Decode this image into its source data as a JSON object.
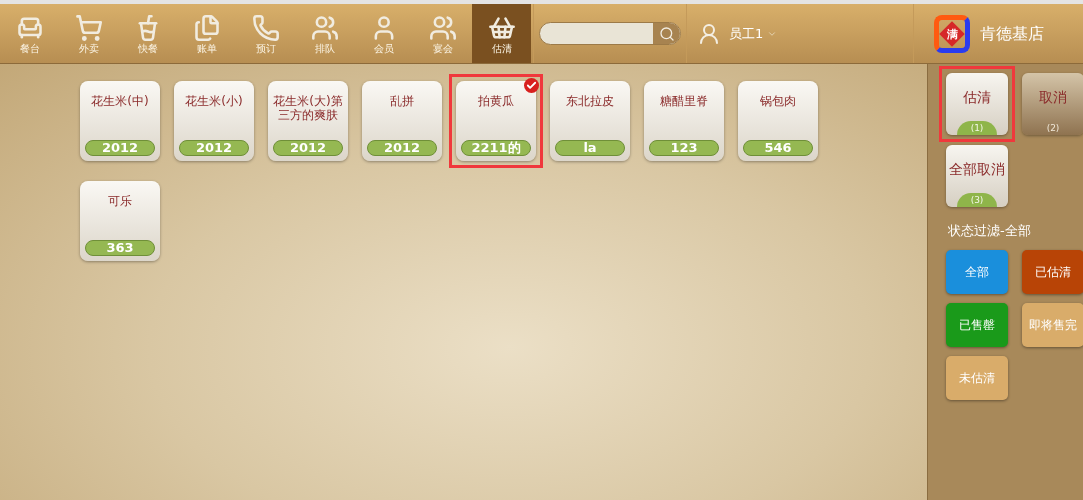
{
  "nav": [
    {
      "label": "餐台",
      "selected": false
    },
    {
      "label": "外卖",
      "selected": false
    },
    {
      "label": "快餐",
      "selected": false
    },
    {
      "label": "账单",
      "selected": false
    },
    {
      "label": "预订",
      "selected": false
    },
    {
      "label": "排队",
      "selected": false
    },
    {
      "label": "会员",
      "selected": false
    },
    {
      "label": "宴会",
      "selected": false
    },
    {
      "label": "估清",
      "selected": true
    }
  ],
  "user": {
    "name": "员工1"
  },
  "brand": {
    "logo_char": "满",
    "name": "肯德基店"
  },
  "dishes": [
    {
      "name": "花生米(中)",
      "count": "2012",
      "checked": false,
      "highlighted": false
    },
    {
      "name": "花生米(小)",
      "count": "2012",
      "checked": false,
      "highlighted": false
    },
    {
      "name": "花生米(大)第三方的爽肤",
      "count": "2012",
      "checked": false,
      "highlighted": false
    },
    {
      "name": "乱拼",
      "count": "2012",
      "checked": false,
      "highlighted": false
    },
    {
      "name": "拍黄瓜",
      "count": "2211的",
      "checked": true,
      "highlighted": true
    },
    {
      "name": "东北拉皮",
      "count": "la",
      "checked": false,
      "highlighted": false
    },
    {
      "name": "糖醋里脊",
      "count": "123",
      "checked": false,
      "highlighted": false
    },
    {
      "name": "锅包肉",
      "count": "546",
      "checked": false,
      "highlighted": false
    },
    {
      "name": "可乐",
      "count": "363",
      "checked": false,
      "highlighted": false
    }
  ],
  "actions": [
    {
      "label": "估清",
      "badge": "(1)",
      "disabled": false,
      "highlighted": true
    },
    {
      "label": "取消",
      "badge": "(2)",
      "disabled": true,
      "highlighted": false
    },
    {
      "label": "全部取消",
      "badge": "(3)",
      "disabled": false,
      "highlighted": false
    }
  ],
  "filter_title": "状态过滤-全部",
  "filters": [
    {
      "label": "全部",
      "color": "#1a8fdc"
    },
    {
      "label": "已估清",
      "color": "#b84406"
    },
    {
      "label": "已售罄",
      "color": "#1a9a1a"
    },
    {
      "label": "即将售完",
      "color": "#d9ac6a"
    },
    {
      "label": "未估清",
      "color": "#d9ac6a"
    }
  ]
}
